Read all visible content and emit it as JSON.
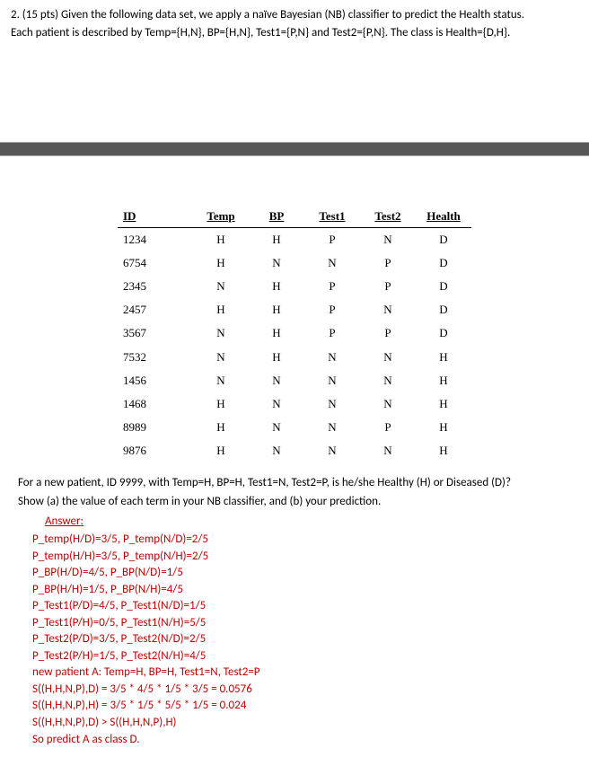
{
  "question": {
    "line1": "2. (15 pts) Given the following data set, we apply a naïve Bayesian (NB) classifier to predict the Health status.",
    "line2": "Each patient is described by Temp={H,N}, BP={H,N}, Test1={P,N} and Test2={P,N}. The class is Health={D,H}."
  },
  "table": {
    "headers": [
      "ID",
      "Temp",
      "BP",
      "Test1",
      "Test2",
      "Health"
    ],
    "rows": [
      [
        "1234",
        "H",
        "H",
        "P",
        "N",
        "D"
      ],
      [
        "6754",
        "H",
        "N",
        "N",
        "P",
        "D"
      ],
      [
        "2345",
        "N",
        "H",
        "P",
        "P",
        "D"
      ],
      [
        "2457",
        "H",
        "H",
        "P",
        "N",
        "D"
      ],
      [
        "3567",
        "N",
        "H",
        "P",
        "P",
        "D"
      ],
      [
        "7532",
        "N",
        "H",
        "N",
        "N",
        "H"
      ],
      [
        "1456",
        "N",
        "N",
        "N",
        "N",
        "H"
      ],
      [
        "1468",
        "H",
        "N",
        "N",
        "N",
        "H"
      ],
      [
        "8989",
        "H",
        "N",
        "N",
        "P",
        "H"
      ],
      [
        "9876",
        "H",
        "N",
        "N",
        "N",
        "H"
      ]
    ]
  },
  "prompt": {
    "line1": "For a new patient, ID 9999, with Temp=H, BP=H, Test1=N, Test2=P, is he/she Healthy (H) or Diseased (D)?",
    "line2": "Show (a) the value of each term in your NB classifier, and (b) your prediction."
  },
  "answer": {
    "label": "Answer:",
    "lines": [
      "P_temp(H/D)=3/5, P_temp(N/D)=2/5",
      "P_temp(H/H)=3/5, P_temp(N/H)=2/5",
      "P_BP(H/D)=4/5, P_BP(N/D)=1/5",
      "P_BP(H/H)=1/5, P_BP(N/H)=4/5",
      "P_Test1(P/D)=4/5, P_Test1(N/D)=1/5",
      "P_Test1(P/H)=0/5, P_Test1(N/H)=5/5",
      "P_Test2(P/D)=3/5, P_Test2(N/D)=2/5",
      "P_Test2(P/H)=1/5, P_Test2(N/H)=4/5",
      "new patient A: Temp=H, BP=H, Test1=N, Test2=P",
      "S((H,H,N,P),D) = 3/5 * 4/5 * 1/5 * 3/5 = 0.0576",
      "S((H,H,N,P),H) = 3/5 * 1/5 * 5/5 * 1/5 = 0.024",
      "S((H,H,N,P),D) > S((H,H,N,P),H)",
      "So predict A as class D."
    ]
  }
}
